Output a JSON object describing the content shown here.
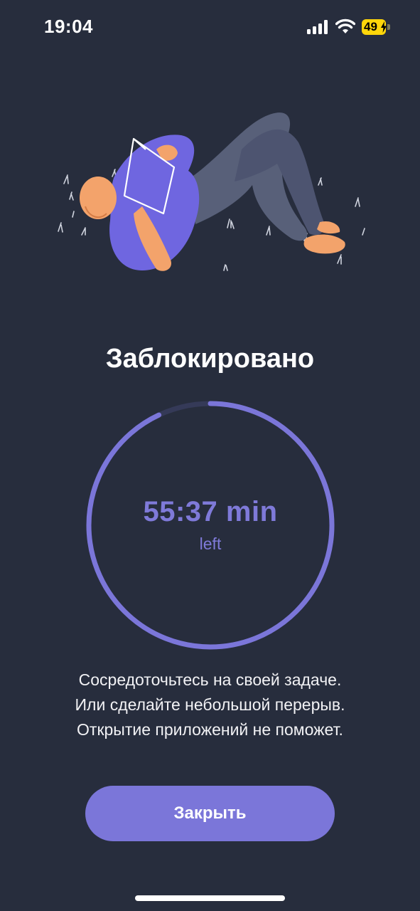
{
  "status_bar": {
    "time": "19:04",
    "battery_level": "49",
    "icons": [
      "signal-icon",
      "wifi-icon",
      "battery-icon",
      "charging-bolt-icon"
    ]
  },
  "illustration": {
    "icon": "person-reading-on-grass-illustration"
  },
  "screen": {
    "title": "Заблокировано"
  },
  "timer": {
    "value": "55:37 min",
    "label": "left",
    "progress_fraction": 0.93
  },
  "message": {
    "lines": [
      "Сосредоточьтесь на своей задаче.",
      "Или сделайте небольшой перерыв.",
      "Открытие приложений не поможет."
    ]
  },
  "actions": {
    "close_label": "Закрыть"
  },
  "colors": {
    "background": "#272d3d",
    "accent": "#7b76d9",
    "ring_track": "#353a58",
    "battery": "#ffd60a"
  }
}
